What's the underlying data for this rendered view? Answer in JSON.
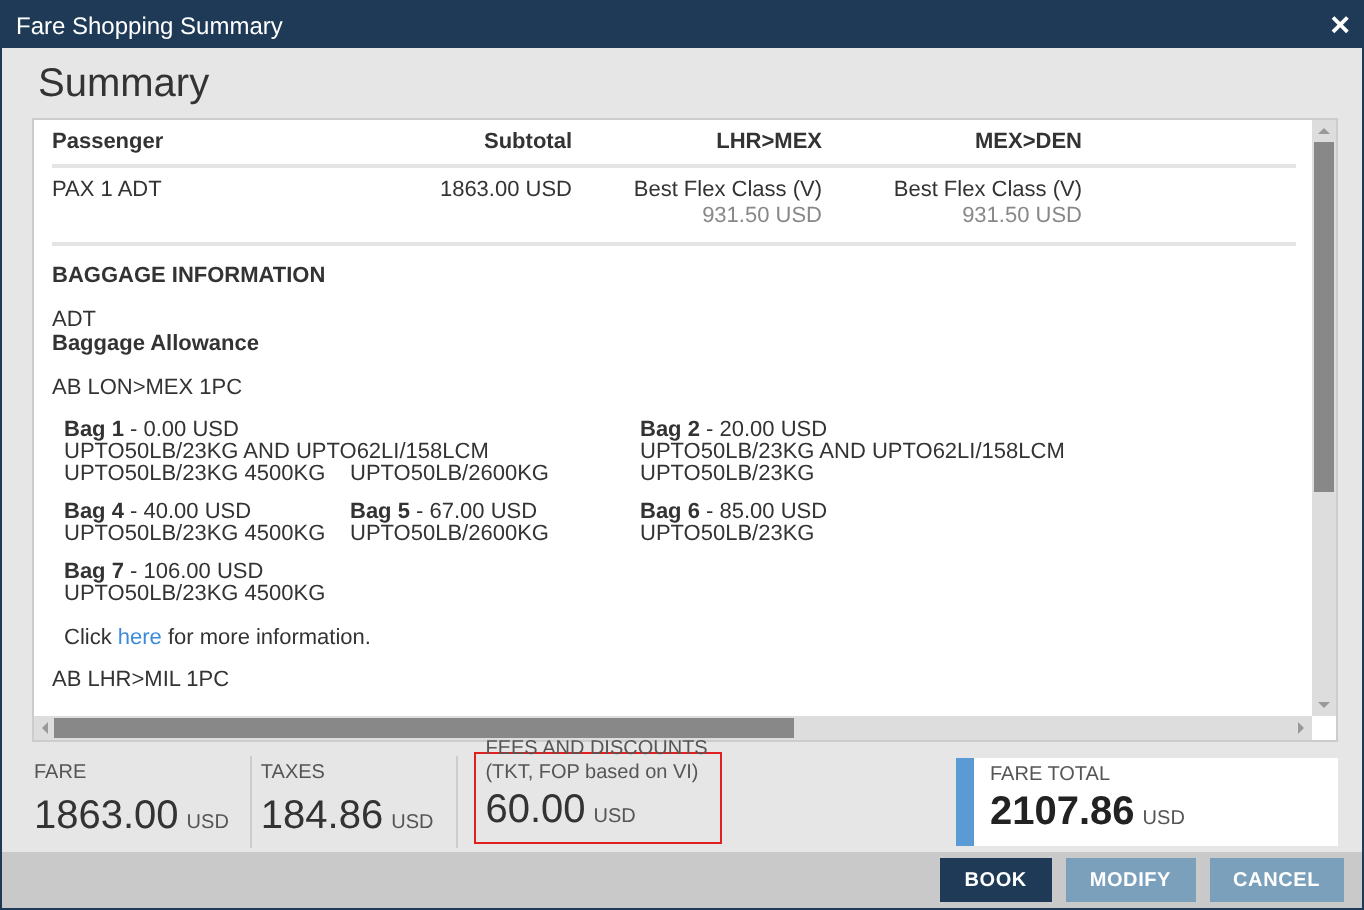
{
  "window": {
    "title": "Fare Shopping Summary",
    "close": "×"
  },
  "heading": "Summary",
  "table": {
    "columns": [
      "Passenger",
      "Subtotal",
      "LHR>MEX",
      "MEX>DEN"
    ],
    "rows": [
      {
        "passenger": "PAX 1 ADT",
        "subtotal": "1863.00 USD",
        "segments": [
          {
            "fare_class": "Best Flex Class (V)",
            "price": "931.50 USD"
          },
          {
            "fare_class": "Best Flex Class (V)",
            "price": "931.50 USD"
          }
        ]
      }
    ]
  },
  "baggage": {
    "title": "BAGGAGE INFORMATION",
    "passenger_type": "ADT",
    "allowance_title": "Baggage Allowance",
    "routes": [
      {
        "route": "AB LON>MEX 1PC",
        "bag_rows": [
          [
            {
              "name": "Bag 1",
              "price": " - 0.00 USD",
              "lines": [
                [
                  "UPTO50LB/23KG AND UPTO62LI/158LCM"
                ],
                [
                  "UPTO50LB/23KG 4500KG",
                  "UPTO50LB/2600KG"
                ]
              ]
            },
            {
              "name": "Bag 2",
              "price": " - 20.00 USD",
              "lines": [
                [
                  "UPTO50LB/23KG AND UPTO62LI/158LCM"
                ],
                [
                  "UPTO50LB/23KG"
                ]
              ]
            }
          ],
          [
            {
              "name": "Bag 4",
              "price": " - 40.00 USD",
              "lines": [
                [
                  "UPTO50LB/23KG 4500KG"
                ]
              ]
            },
            {
              "name": "Bag 5",
              "price": " - 67.00 USD",
              "lines": [
                [
                  "UPTO50LB/2600KG"
                ]
              ]
            },
            {
              "name": "Bag 6",
              "price": " - 85.00 USD",
              "lines": [
                [
                  "UPTO50LB/23KG"
                ]
              ]
            }
          ],
          [
            {
              "name": "Bag 7",
              "price": " - 106.00 USD",
              "lines": [
                [
                  "UPTO50LB/23KG 4500KG"
                ]
              ]
            }
          ]
        ],
        "info": {
          "before": "Click ",
          "link": "here",
          "after": " for more information."
        }
      },
      {
        "route": "AB LHR>MIL 1PC"
      }
    ]
  },
  "totals": [
    {
      "label": "FARE",
      "amount": "1863.00",
      "currency": "USD",
      "highlighted": false
    },
    {
      "label": "TAXES",
      "amount": "184.86",
      "currency": "USD",
      "highlighted": false
    },
    {
      "label": "FEES AND DISCOUNTS",
      "note": "(TKT, FOP based on VI)",
      "amount": "60.00",
      "currency": "USD",
      "highlighted": true
    }
  ],
  "fare_total": {
    "label": "FARE TOTAL",
    "amount": "2107.86",
    "currency": "USD"
  },
  "buttons": [
    {
      "label": "BOOK",
      "kind": "primary"
    },
    {
      "label": "MODIFY",
      "kind": "secondary"
    },
    {
      "label": "CANCEL",
      "kind": "secondary"
    }
  ]
}
